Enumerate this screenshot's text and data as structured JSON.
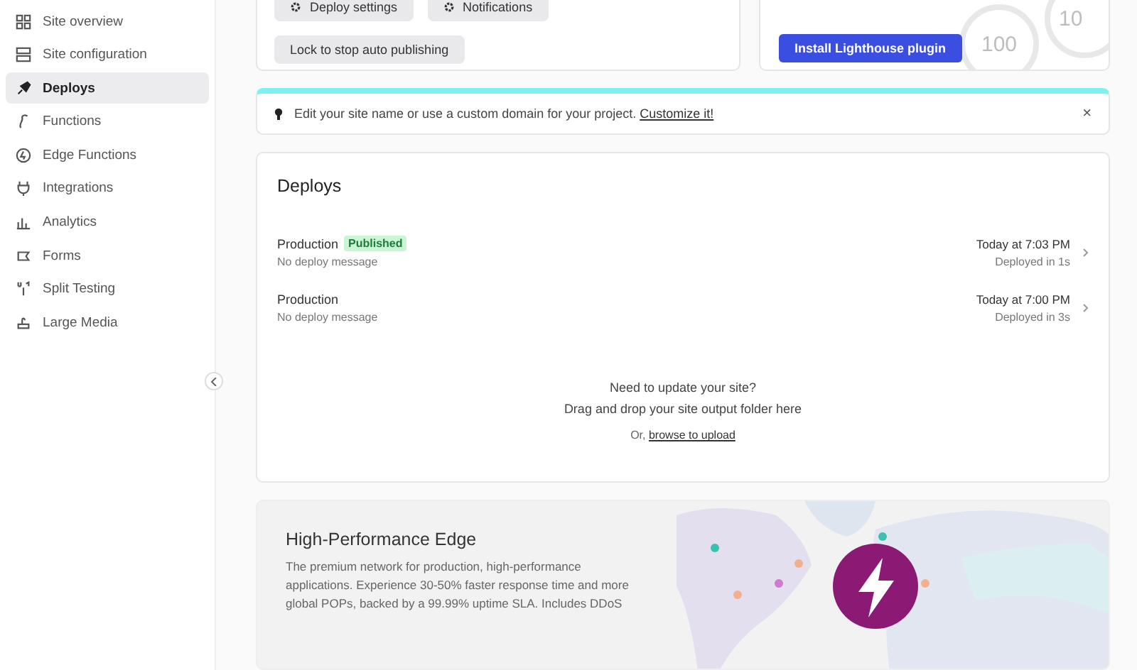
{
  "sidebar": {
    "items": [
      {
        "label": "Site overview",
        "selected": false
      },
      {
        "label": "Site configuration",
        "selected": false
      },
      {
        "label": "Deploys",
        "selected": true
      },
      {
        "label": "Functions",
        "selected": false
      },
      {
        "label": "Edge Functions",
        "selected": false
      },
      {
        "label": "Integrations",
        "selected": false
      },
      {
        "label": "Analytics",
        "selected": false
      },
      {
        "label": "Forms",
        "selected": false
      },
      {
        "label": "Split Testing",
        "selected": false
      },
      {
        "label": "Large Media",
        "selected": false
      }
    ]
  },
  "settings_card": {
    "buttons": [
      "Deploy settings",
      "Notifications"
    ],
    "lock_button": "Lock to stop auto publishing"
  },
  "lighthouse_card": {
    "button": "Install Lighthouse plugin",
    "scores": [
      "100",
      "10"
    ]
  },
  "banner": {
    "text": "Edit your site name or use a custom domain for your project.",
    "link": "Customize it!",
    "close": "×"
  },
  "deploys": {
    "title": "Deploys",
    "rows": [
      {
        "name": "Production",
        "badge": "Published",
        "message": "No deploy message",
        "time": "Today at 7:03 PM",
        "duration": "Deployed in 1s"
      },
      {
        "name": "Production",
        "message": "No deploy message",
        "time": "Today at 7:00 PM",
        "duration": "Deployed in 3s"
      }
    ],
    "dropzone": {
      "heading": "Need to update your site?",
      "text": "Drag and drop your site output folder here",
      "prefix": "Or,",
      "link": "browse to upload"
    }
  },
  "edge": {
    "title": "High-Performance Edge",
    "description": "The premium network for production, high-performance applications. Experience 30-50% faster response time and more global POPs, backed by a 99.99% uptime SLA. Includes DDoS"
  }
}
